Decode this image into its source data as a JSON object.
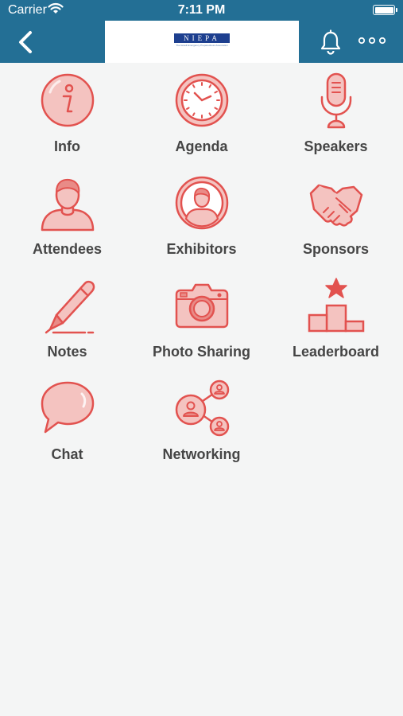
{
  "status_bar": {
    "carrier": "Carrier",
    "time": "7:11 PM"
  },
  "header": {
    "logo_word": "NIEPA",
    "logo_tagline": "The Israeli Emergency Preparedness Association",
    "bar_color": "#236f95"
  },
  "accent_color": "#e2524f",
  "tiles": [
    {
      "label": "Info",
      "icon": "info-icon"
    },
    {
      "label": "Agenda",
      "icon": "clock-icon"
    },
    {
      "label": "Speakers",
      "icon": "microphone-icon"
    },
    {
      "label": "Attendees",
      "icon": "person-icon"
    },
    {
      "label": "Exhibitors",
      "icon": "person-circle-icon"
    },
    {
      "label": "Sponsors",
      "icon": "handshake-icon"
    },
    {
      "label": "Notes",
      "icon": "pen-icon"
    },
    {
      "label": "Photo Sharing",
      "icon": "camera-icon"
    },
    {
      "label": "Leaderboard",
      "icon": "podium-icon"
    },
    {
      "label": "Chat",
      "icon": "chat-bubble-icon"
    },
    {
      "label": "Networking",
      "icon": "network-icon"
    }
  ]
}
